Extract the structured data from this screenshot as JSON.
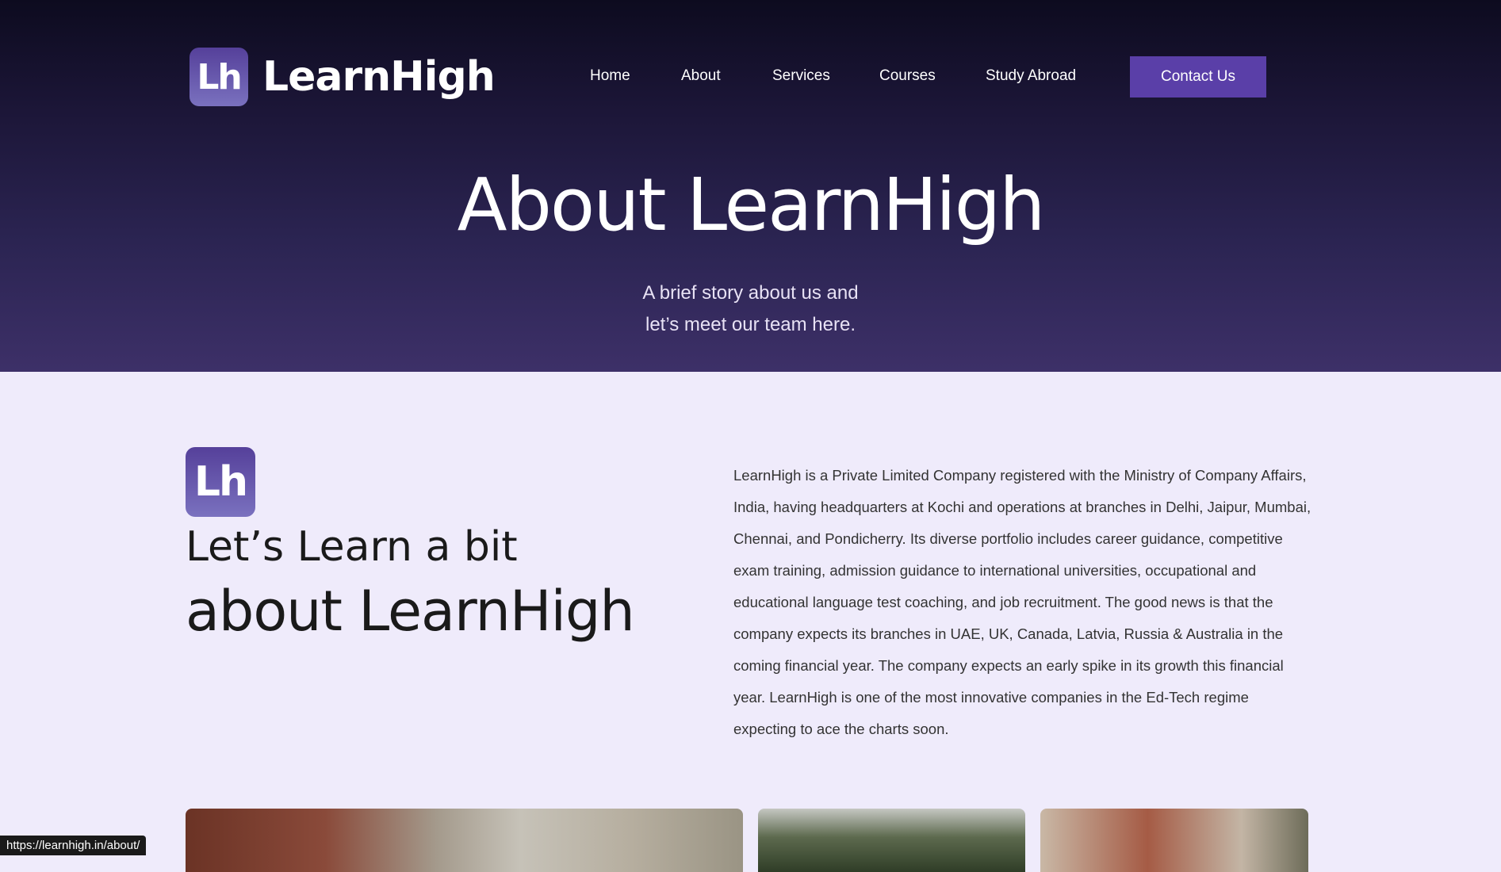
{
  "brand": {
    "badge": "Lh",
    "name": "LearnHigh"
  },
  "nav": {
    "items": [
      {
        "label": "Home"
      },
      {
        "label": "About"
      },
      {
        "label": "Services"
      },
      {
        "label": "Courses"
      },
      {
        "label": "Study Abroad"
      }
    ],
    "contact_label": "Contact Us"
  },
  "hero": {
    "title": "About LearnHigh",
    "subtitle_line1": "A brief story about us and",
    "subtitle_line2": "let’s meet our team here."
  },
  "about": {
    "badge": "Lh",
    "heading_line1": "Let’s Learn a bit",
    "heading_line2": "about LearnHigh",
    "paragraph": "LearnHigh is a Private Limited Company registered with the Ministry of Company Affairs, India, having headquarters at Kochi and operations at branches in Delhi, Jaipur, Mumbai, Chennai, and Pondicherry. Its diverse portfolio includes career guidance, competitive exam training, admission guidance to international universities, occupational and educational language test coaching, and job recruitment. The good news is that the company expects its branches in UAE, UK, Canada, Latvia, Russia & Australia in the coming financial year. The company expects an early spike in its growth this financial year. LearnHigh is one of the most innovative companies in the Ed-Tech regime expecting to ace the charts soon."
  },
  "status_bar": {
    "url": "https://learnhigh.in/about/"
  },
  "colors": {
    "accent": "#5a3fa8",
    "hero_top": "#0d0b1f",
    "hero_bottom": "#3d3068",
    "page_bg": "#efebfb"
  }
}
